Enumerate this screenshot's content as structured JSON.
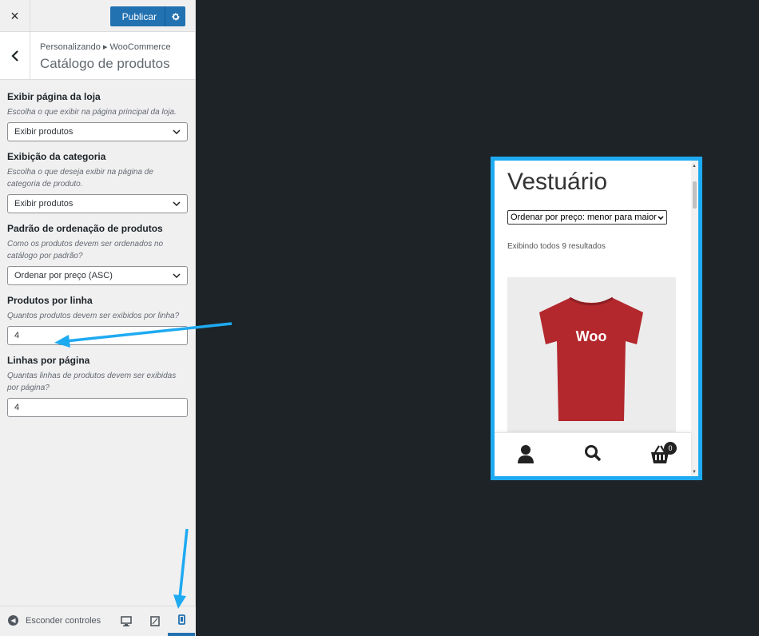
{
  "topbar": {
    "close_icon": "×",
    "publish_label": "Publicar"
  },
  "section": {
    "breadcrumb": "Personalizando ▸ WooCommerce",
    "title": "Catálogo de produtos"
  },
  "controls": {
    "shop_display": {
      "label": "Exibir página da loja",
      "description": "Escolha o que exibir na página principal da loja.",
      "value": "Exibir produtos"
    },
    "category_display": {
      "label": "Exibição da categoria",
      "description": "Escolha o que deseja exibir na página de categoria de produto.",
      "value": "Exibir produtos"
    },
    "default_sorting": {
      "label": "Padrão de ordenação de produtos",
      "description": "Como os produtos devem ser ordenados no catálogo por padrão?",
      "value": "Ordenar por preço (ASC)"
    },
    "products_per_row": {
      "label": "Produtos por linha",
      "description": "Quantos produtos devem ser exibidos por linha?",
      "value": "4"
    },
    "rows_per_page": {
      "label": "Linhas por página",
      "description": "Quantas linhas de produtos devem ser exibidas por página?",
      "value": "4"
    }
  },
  "footer": {
    "hide_controls_label": "Esconder controles"
  },
  "preview": {
    "title": "Vestuário",
    "sort_select": "Ordenar por preço: menor para maior",
    "result_count": "Exibindo todos 9 resultados",
    "product_logo_text": "Woo",
    "cart_count": "0"
  },
  "colors": {
    "accent": "#2271b1",
    "highlight": "#1eaaf1",
    "preview_bg": "#1d2327",
    "tshirt": "#b3282d"
  }
}
